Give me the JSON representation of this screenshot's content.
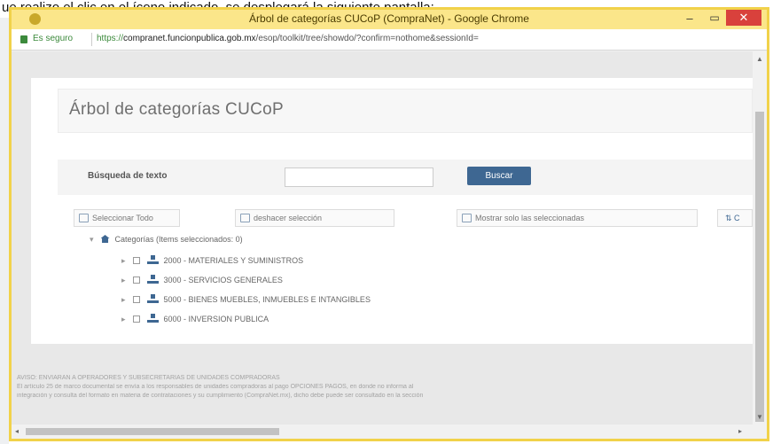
{
  "caption": "ue realizo el clic en el ícono indicado, se desplegará la siguiente pantalla:",
  "window": {
    "title": "Árbol de categorías CUCoP (CompraNet) - Google Chrome",
    "minimize": "–",
    "maximize": "▭",
    "close": "✕"
  },
  "address": {
    "secure_label": "Es seguro",
    "url_protocol": "https://",
    "url_domain": "compranet.funcionpublica.gob.mx",
    "url_path": "/esop/toolkit/tree/showdo/?confirm=nothome&sessionId="
  },
  "modal": {
    "title": "Árbol de categorías CUCoP",
    "search_label": "Búsqueda de texto",
    "search_value": "",
    "search_button": "Buscar",
    "buttons": {
      "select_all": "Seleccionar Todo",
      "deselect": "deshacer selección",
      "show_selected": "Mostrar solo las seleccionadas",
      "more": "C"
    },
    "tree": {
      "root_label": "Categorías (Items seleccionados: 0)",
      "items": [
        {
          "label": "2000 - MATERIALES Y SUMINISTROS"
        },
        {
          "label": "3000 - SERVICIOS GENERALES"
        },
        {
          "label": "5000 - BIENES MUEBLES, INMUEBLES E INTANGIBLES"
        },
        {
          "label": "6000 - INVERSION PUBLICA"
        }
      ]
    }
  },
  "footer": {
    "line1": "AVISO: ENVIARÁN A OPERADORES Y SUBSECRETARÍAS DE UNIDADES COMPRADORAS",
    "line2": "El artículo 25 de marco documental se envía a los responsables de unidades compradoras al pago OPCIONES PAGOS, en donde no informa al",
    "line3": "integración y consulta del formato en materia de contrataciones y su cumplimiento (CompraNet.mx), dicho debe puede ser consultado en la sección"
  },
  "colors": {
    "accent": "#3e6792",
    "titlebar": "#fbe68a",
    "frame": "#f1d24a",
    "close": "#d9413c"
  }
}
